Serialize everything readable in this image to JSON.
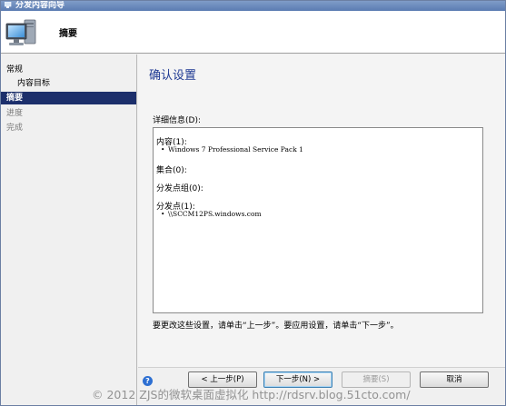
{
  "window": {
    "title": "分发内容向导"
  },
  "header": {
    "title": "摘要"
  },
  "nav": {
    "items": [
      {
        "label": "常规",
        "level": "group",
        "state": "done"
      },
      {
        "label": "内容目标",
        "level": "sub",
        "state": "done"
      },
      {
        "label": "摘要",
        "level": "group",
        "state": "active"
      },
      {
        "label": "进度",
        "level": "group",
        "state": "future"
      },
      {
        "label": "完成",
        "level": "group",
        "state": "future"
      }
    ]
  },
  "content": {
    "title": "确认设置",
    "details_label": "详细信息(D):",
    "sections": [
      {
        "heading": "内容(1):",
        "items": [
          "Windows 7 Professional Service Pack 1"
        ]
      },
      {
        "heading": "集合(0):",
        "items": []
      },
      {
        "heading": "分发点组(0):",
        "items": []
      },
      {
        "heading": "分发点(1):",
        "items": [
          "\\\\SCCM12PS.windows.com"
        ]
      }
    ],
    "bullet": "•",
    "instruction": "要更改这些设置，请单击“上一步”。要应用设置，请单击“下一步”。"
  },
  "footer": {
    "help_glyph": "?",
    "buttons": {
      "back": "< 上一步(P)",
      "next": "下一步(N) >",
      "summary": "摘要(S)",
      "cancel": "取消"
    }
  },
  "watermark": "© 2012 ZJS的微软桌面虚拟化 http://rdsrv.blog.51cto.com/",
  "colors": {
    "title_accent": "#1f3a93",
    "nav_active_bg": "#1c2f6b",
    "titlebar": "#5b7cb2"
  }
}
